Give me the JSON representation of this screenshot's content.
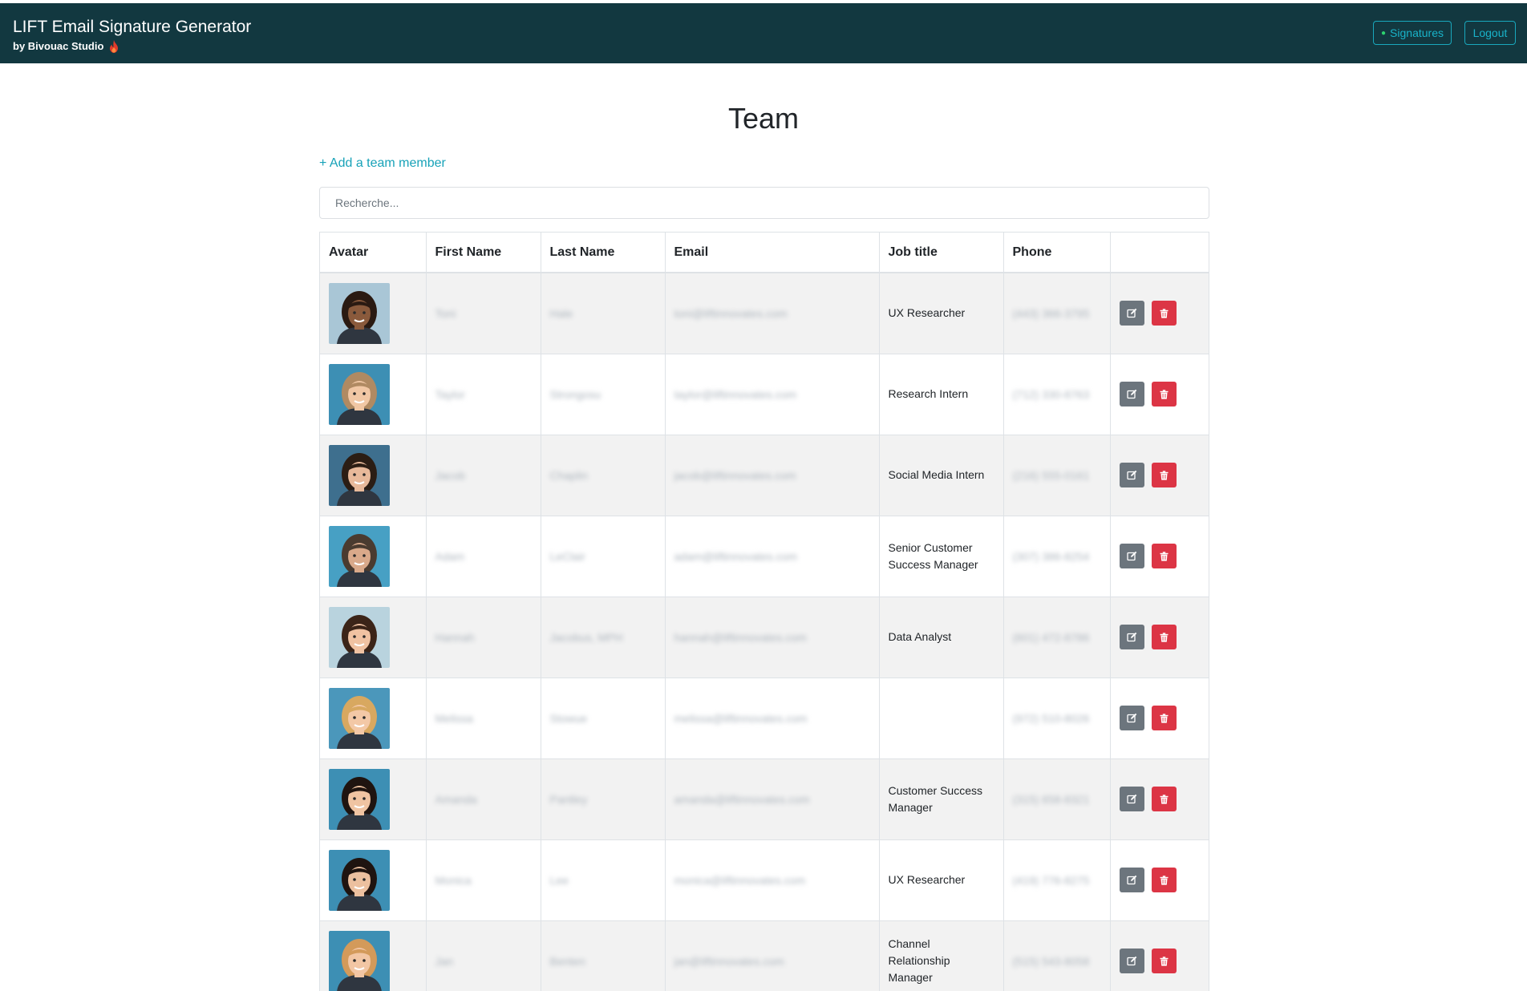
{
  "app": {
    "title": "LIFT Email Signature Generator",
    "subtitle": "by Bivouac Studio"
  },
  "nav": {
    "signatures_label": "Signatures",
    "logout_label": "Logout"
  },
  "page": {
    "title": "Team",
    "add_link": "+ Add a team member",
    "search_placeholder": "Recherche..."
  },
  "table": {
    "headers": [
      "Avatar",
      "First Name",
      "Last Name",
      "Email",
      "Job title",
      "Phone",
      ""
    ],
    "rows": [
      {
        "first": "Toni",
        "last": "Hale",
        "email": "toni@liftinnovates.com",
        "job": "UX Researcher",
        "phone": "(443) 366-3795",
        "avatar": {
          "bg": "#a9c6d6",
          "skin": "#8a5a3c",
          "hair": "#2a1a12"
        }
      },
      {
        "first": "Taylor",
        "last": "Strongosu",
        "email": "taylor@liftinnovates.com",
        "job": "Research Intern",
        "phone": "(712) 330-8763",
        "avatar": {
          "bg": "#3d8fb4",
          "skin": "#f1c7a4",
          "hair": "#b08a62"
        }
      },
      {
        "first": "Jacob",
        "last": "Chaplin",
        "email": "jacob@liftinnovates.com",
        "job": "Social Media Intern",
        "phone": "(216) 555-0161",
        "avatar": {
          "bg": "#3e6f8e",
          "skin": "#e8b99a",
          "hair": "#2b1d14"
        }
      },
      {
        "first": "Adam",
        "last": "LeClair",
        "email": "adam@liftinnovates.com",
        "job": "Senior Customer Success Manager",
        "phone": "(307) 386-8254",
        "avatar": {
          "bg": "#47a0c4",
          "skin": "#d9a98a",
          "hair": "#4a3b30"
        }
      },
      {
        "first": "Hannah",
        "last": "Jacobus, MPH",
        "email": "hannah@liftinnovates.com",
        "job": "Data Analyst",
        "phone": "(601) 472-8786",
        "avatar": {
          "bg": "#b9d3de",
          "skin": "#f0c2a2",
          "hair": "#3b2418"
        }
      },
      {
        "first": "Melissa",
        "last": "Stowue",
        "email": "melissa@liftinnovates.com",
        "job": "",
        "phone": "(972) 510-8026",
        "avatar": {
          "bg": "#4b97bb",
          "skin": "#f3c8a6",
          "hair": "#d8a860"
        }
      },
      {
        "first": "Amanda",
        "last": "Pantley",
        "email": "amanda@liftinnovates.com",
        "job": "Customer Success Manager",
        "phone": "(315) 658-8321",
        "avatar": {
          "bg": "#3d8fb4",
          "skin": "#f0c4a2",
          "hair": "#1f1410"
        }
      },
      {
        "first": "Monica",
        "last": "Lee",
        "email": "monica@liftinnovates.com",
        "job": "UX Researcher",
        "phone": "(419) 776-8275",
        "avatar": {
          "bg": "#3d8fb4",
          "skin": "#ecc09f",
          "hair": "#1f1410"
        }
      },
      {
        "first": "Jan",
        "last": "Benten",
        "email": "jan@liftinnovates.com",
        "job": "Channel Relationship Manager",
        "phone": "(515) 543-8058",
        "avatar": {
          "bg": "#3d8fb4",
          "skin": "#f2c6a4",
          "hair": "#d39a5a"
        }
      }
    ]
  },
  "colors": {
    "navbar": "#123840",
    "accent": "#17a2b8",
    "edit_button": "#6c757d",
    "delete_button": "#dc3545",
    "active_dot": "#2dd36f"
  },
  "icons": {
    "brand": "flame-icon",
    "edit": "edit-icon",
    "delete": "trash-icon"
  }
}
